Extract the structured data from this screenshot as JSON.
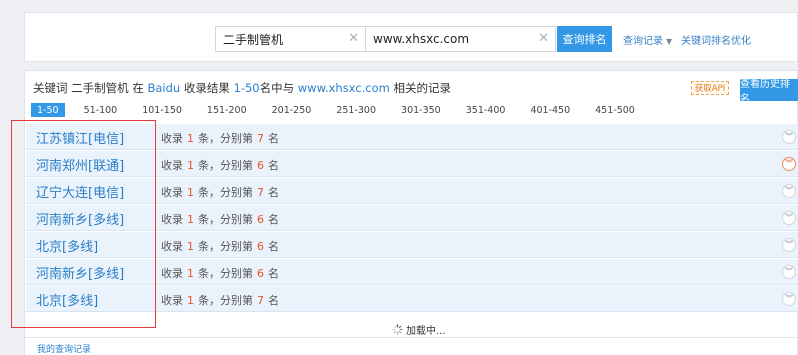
{
  "search": {
    "keyword_value": "二手制管机",
    "site_value": "www.xhsxc.com",
    "query_button": "查询排名",
    "history_link": "查询记录",
    "optimize_link": "关键词排名优化"
  },
  "results": {
    "summary": {
      "prefix": "关键词",
      "keyword": "二手制管机",
      "in": "在",
      "engine": "Baidu",
      "mid": "收录结果",
      "range": "1-50",
      "mid2": "名中与",
      "site": "www.xhsxc.com",
      "suffix": "相关的记录"
    },
    "api_button": "获取API",
    "history_button": "查看历史排名",
    "range_tabs": [
      "1-50",
      "51-100",
      "101-150",
      "151-200",
      "201-250",
      "251-300",
      "301-350",
      "351-400",
      "401-450",
      "451-500"
    ],
    "stat_labels": {
      "indexed": "收录",
      "count_unit": "条，分别第",
      "rank_unit": "名"
    },
    "rows": [
      {
        "region": "江苏镇江[电信]",
        "count": "1",
        "rank": "7"
      },
      {
        "region": "河南郑州[联通]",
        "count": "1",
        "rank": "6"
      },
      {
        "region": "辽宁大连[电信]",
        "count": "1",
        "rank": "7"
      },
      {
        "region": "河南新乡[多线]",
        "count": "1",
        "rank": "6"
      },
      {
        "region": "北京[多线]",
        "count": "1",
        "rank": "6"
      },
      {
        "region": "河南新乡[多线]",
        "count": "1",
        "rank": "6"
      },
      {
        "region": "北京[多线]",
        "count": "1",
        "rank": "7"
      }
    ],
    "loading_text": "加载中...",
    "my_records": "我的查询记录"
  },
  "colors": {
    "accent": "#3399e6",
    "link": "#2a7fc9",
    "rank_number": "#e8552b",
    "highlight_frame": "#e23b3b"
  },
  "icons": {
    "clear": "close-icon",
    "expand": "chevron-double-down-icon",
    "loading": "spinner-icon"
  }
}
